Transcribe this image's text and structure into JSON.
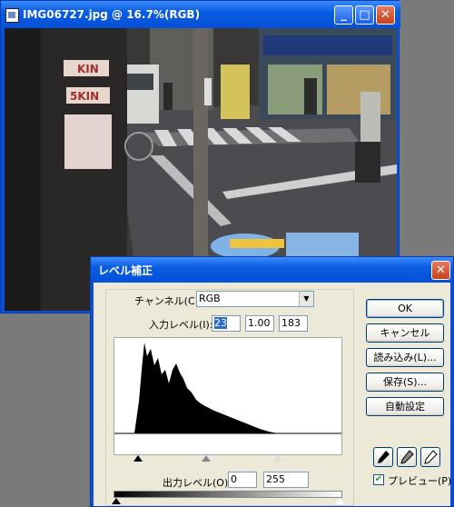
{
  "image_window": {
    "title": "IMG06727.jpg @ 16.7%(RGB)",
    "icon": "document-icon",
    "photo_signs": [
      "KIN",
      "5KIN"
    ]
  },
  "dialog": {
    "title": "レベル補正",
    "channel_label": "チャンネル(C):",
    "channel_value": "RGB",
    "input_label": "入力レベル(I):",
    "input_values": [
      "23",
      "1.00",
      "183"
    ],
    "output_label": "出力レベル(O):",
    "output_values": [
      "0",
      "255"
    ],
    "buttons": {
      "ok": "OK",
      "cancel": "キャンセル",
      "load": "読み込み(L)...",
      "save": "保存(S)...",
      "auto": "自動設定"
    },
    "preview_label": "プレビュー(P)",
    "preview_checked": true
  },
  "colors": {
    "titlebar": "#0a5ce0",
    "dialog_face": "#ece9d8"
  }
}
